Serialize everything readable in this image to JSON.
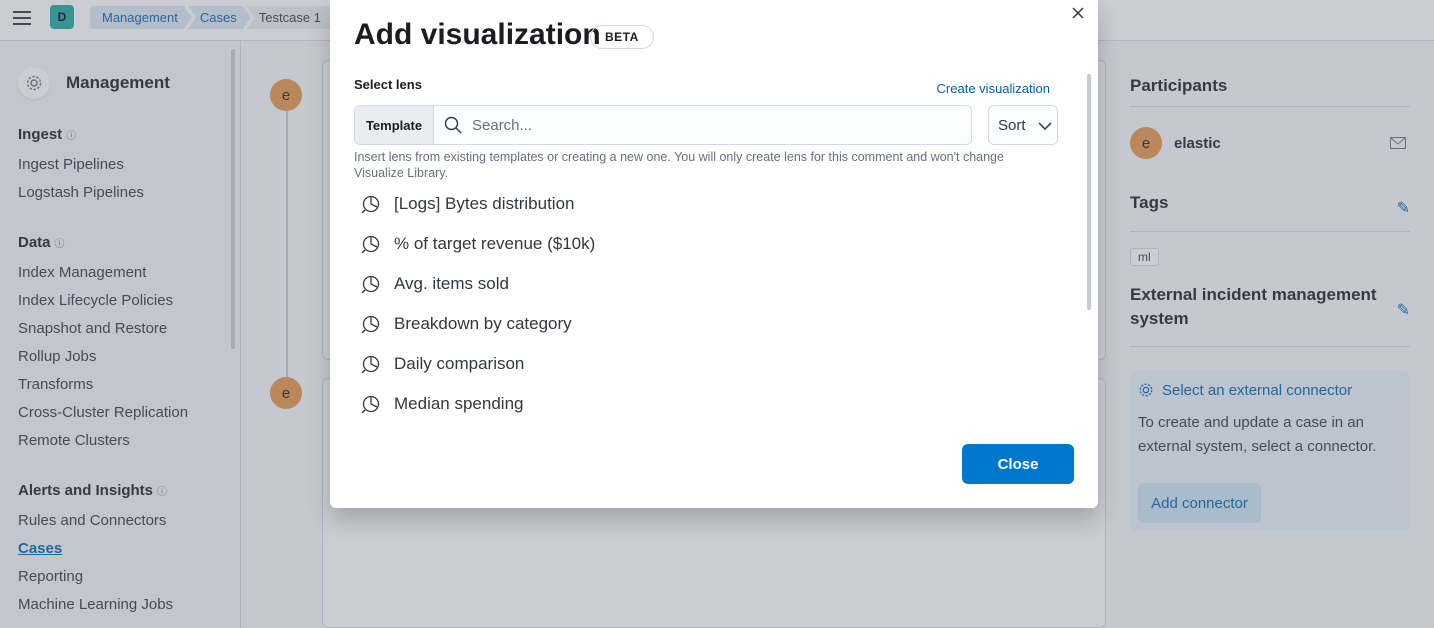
{
  "header": {
    "space_initial": "D",
    "breadcrumbs": [
      "Management",
      "Cases",
      "Testcase 1"
    ]
  },
  "sidebar": {
    "title": "Management",
    "sections": [
      {
        "title": "Ingest",
        "items": [
          "Ingest Pipelines",
          "Logstash Pipelines"
        ]
      },
      {
        "title": "Data",
        "items": [
          "Index Management",
          "Index Lifecycle Policies",
          "Snapshot and Restore",
          "Rollup Jobs",
          "Transforms",
          "Cross-Cluster Replication",
          "Remote Clusters"
        ]
      },
      {
        "title": "Alerts and Insights",
        "items": [
          "Rules and Connectors",
          "Cases",
          "Reporting",
          "Machine Learning Jobs"
        ]
      }
    ],
    "active_item": "Cases"
  },
  "timeline": {
    "avatar_initial": "e"
  },
  "right_panel": {
    "participants_title": "Participants",
    "participant_initial": "e",
    "participant_name": "elastic",
    "tags_title": "Tags",
    "tag": "ml",
    "external_title": "External incident management system",
    "connector_title": "Select an external connector",
    "connector_desc": "To create and update a case in an external system, select a connector.",
    "add_connector_label": "Add connector"
  },
  "modal": {
    "title": "Add visualization",
    "badge": "BETA",
    "select_lens_label": "Select lens",
    "create_link": "Create visualization",
    "prepend_label": "Template",
    "search_placeholder": "Search...",
    "sort_label": "Sort",
    "help_text": "Insert lens from existing templates or creating a new one. You will only create lens for this comment and won't change Visualize Library.",
    "lenses": [
      "[Logs] Bytes distribution",
      "% of target revenue ($10k)",
      "Avg. items sold",
      "Breakdown by category",
      "Daily comparison",
      "Median spending"
    ],
    "close_label": "Close"
  },
  "colors": {
    "primary": "#0077cc",
    "link": "#0061a6",
    "avatar": "#e7964b",
    "space": "#1ba9a0"
  }
}
